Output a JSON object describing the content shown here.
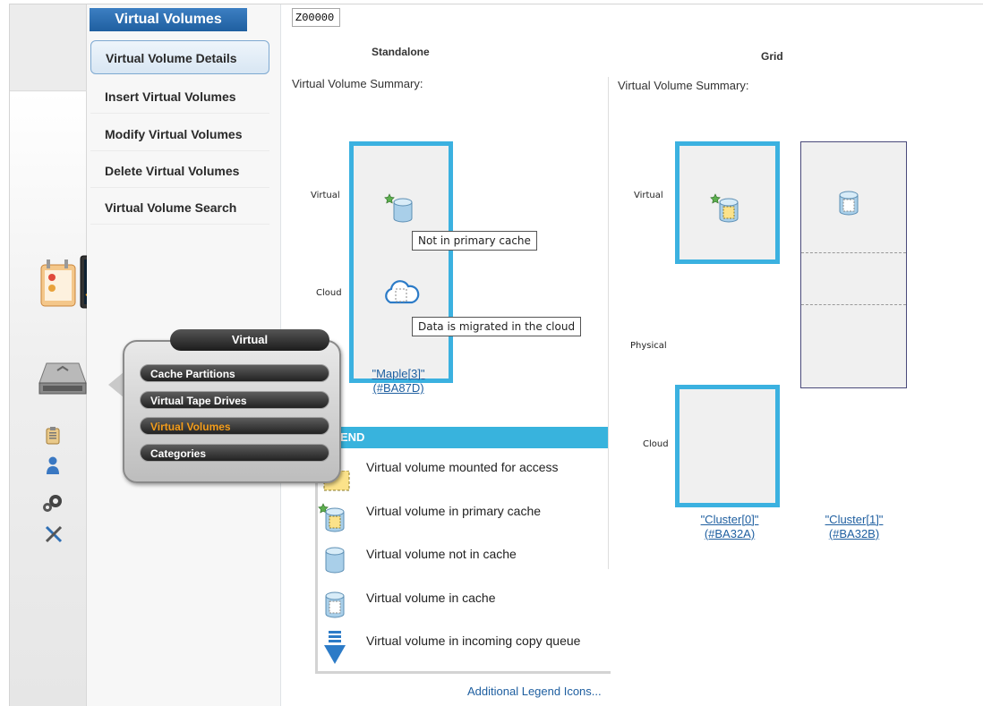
{
  "submenu": {
    "title": "Virtual Volumes",
    "items": [
      {
        "label": "Virtual Volume Details",
        "active": true
      },
      {
        "label": "Insert Virtual Volumes",
        "active": false
      },
      {
        "label": "Modify Virtual Volumes",
        "active": false
      },
      {
        "label": "Delete Virtual Volumes",
        "active": false
      },
      {
        "label": "Virtual Volume Search",
        "active": false
      }
    ]
  },
  "search": {
    "value": "Z00000"
  },
  "standalone": {
    "title": "Standalone",
    "summary_label": "Virtual Volume Summary:",
    "rows": {
      "virtual": "Virtual",
      "cloud": "Cloud"
    },
    "tooltips": {
      "not_in_cache": "Not in primary cache",
      "migrated": "Data is migrated in the cloud"
    },
    "cluster_link": {
      "name": "\"Maple[3]\"",
      "id": "(#BA87D)"
    }
  },
  "grid": {
    "title": "Grid",
    "summary_label": "Virtual Volume Summary:",
    "rows": {
      "virtual": "Virtual",
      "physical": "Physical",
      "cloud": "Cloud"
    },
    "clusters": [
      {
        "name": "\"Cluster[0]\"",
        "id": "(#BA32A)"
      },
      {
        "name": "\"Cluster[1]\"",
        "id": "(#BA32B)"
      }
    ]
  },
  "legend": {
    "header": "END",
    "items": [
      {
        "icon": "mounted-volume-icon",
        "label": "Virtual volume mounted for access"
      },
      {
        "icon": "primary-cache-volume-icon",
        "label": "Virtual volume in primary cache"
      },
      {
        "icon": "not-in-cache-volume-icon",
        "label": "Virtual volume not in cache"
      },
      {
        "icon": "in-cache-volume-icon",
        "label": "Virtual volume in cache"
      },
      {
        "icon": "incoming-copy-queue-icon",
        "label": "Virtual volume in incoming copy queue"
      }
    ],
    "more_link": "Additional Legend Icons..."
  },
  "popup": {
    "title": "Virtual",
    "items": [
      {
        "label": "Cache Partitions",
        "selected": false
      },
      {
        "label": "Virtual Tape Drives",
        "selected": false
      },
      {
        "label": "Virtual Volumes",
        "selected": true
      },
      {
        "label": "Categories",
        "selected": false
      }
    ]
  },
  "colors": {
    "accent_blue": "#3bb1e0",
    "nav_blue": "#1f5fa0",
    "popup_selected": "#f39c1a"
  }
}
